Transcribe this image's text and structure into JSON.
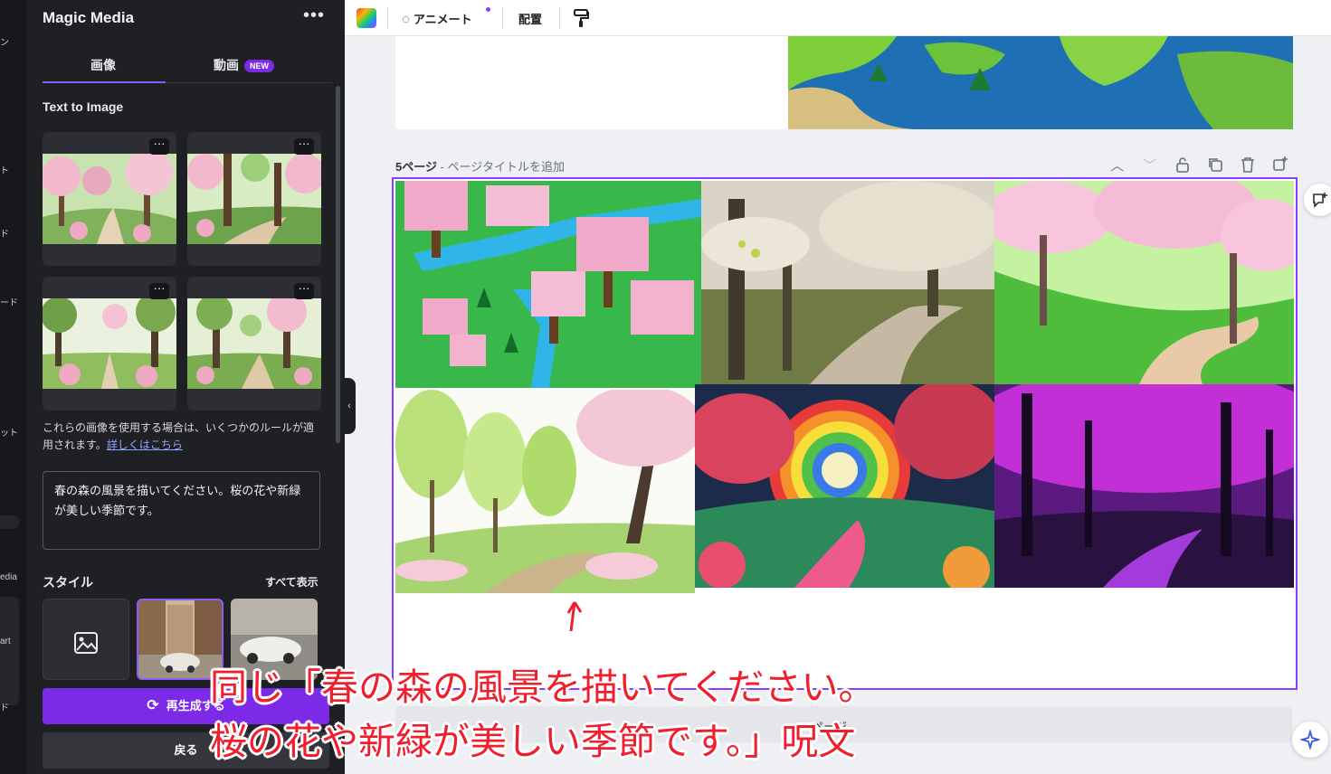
{
  "rail": {
    "fragments": [
      "ン",
      "ト",
      "ド",
      "ード",
      "ット",
      "edia",
      "art",
      "ド"
    ]
  },
  "panel": {
    "title": "Magic Media",
    "more_label": "•••",
    "tabs": [
      {
        "label": "画像",
        "active": true
      },
      {
        "label": "動画",
        "badge": "NEW"
      }
    ],
    "section_label": "Text to Image",
    "thumb_more": "···",
    "note_text": "これらの画像を使用する場合は、いくつかのルールが適用されます。",
    "note_link": "詳しくはこちら",
    "prompt_text": "春の森の風景を描いてください。桜の花や新緑が美しい季節です。",
    "style_title": "スタイル",
    "style_all": "すべて表示",
    "regenerate_label": "再生成する",
    "back_label": "戻る"
  },
  "toolbar": {
    "animate_label": "アニメート",
    "arrange_label": "配置"
  },
  "canvas": {
    "page_number": "5ページ",
    "page_title_placeholder": " - ページタイトルを追加",
    "add_page_label": "+ ページ"
  },
  "annotation": {
    "line1": "同じ「春の森の風景を描いてください。",
    "line2": "桜の花や新緑が美しい季節です。」呪文"
  },
  "colors": {
    "accent": "#7d2ae8",
    "page_outline": "#8b3dff",
    "annotation": "#f01f2e"
  }
}
